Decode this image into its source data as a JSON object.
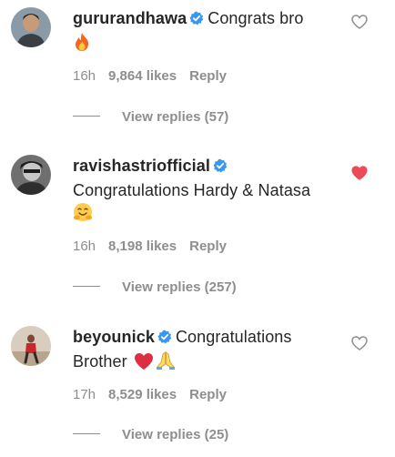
{
  "comments": [
    {
      "username": "gururandhawa",
      "text": "Congrats bro",
      "emojis": [
        "fire"
      ],
      "time": "16h",
      "likes": "9,864 likes",
      "reply_label": "Reply",
      "view_replies": "View replies (57)",
      "liked": false
    },
    {
      "username": "ravishastriofficial",
      "text": "Congratulations Hardy & Natasa",
      "emojis": [
        "hugging-face"
      ],
      "time": "16h",
      "likes": "8,198 likes",
      "reply_label": "Reply",
      "view_replies": "View replies (257)",
      "liked": true
    },
    {
      "username": "beyounick",
      "text": "Congratulations Brother",
      "emojis": [
        "red-heart",
        "folded-hands"
      ],
      "time": "17h",
      "likes": "8,529 likes",
      "reply_label": "Reply",
      "view_replies": "View replies (25)",
      "liked": false
    }
  ],
  "colors": {
    "verified": "#3897f0",
    "liked_heart": "#ed4956",
    "secondary_text": "#8e8e8e"
  }
}
